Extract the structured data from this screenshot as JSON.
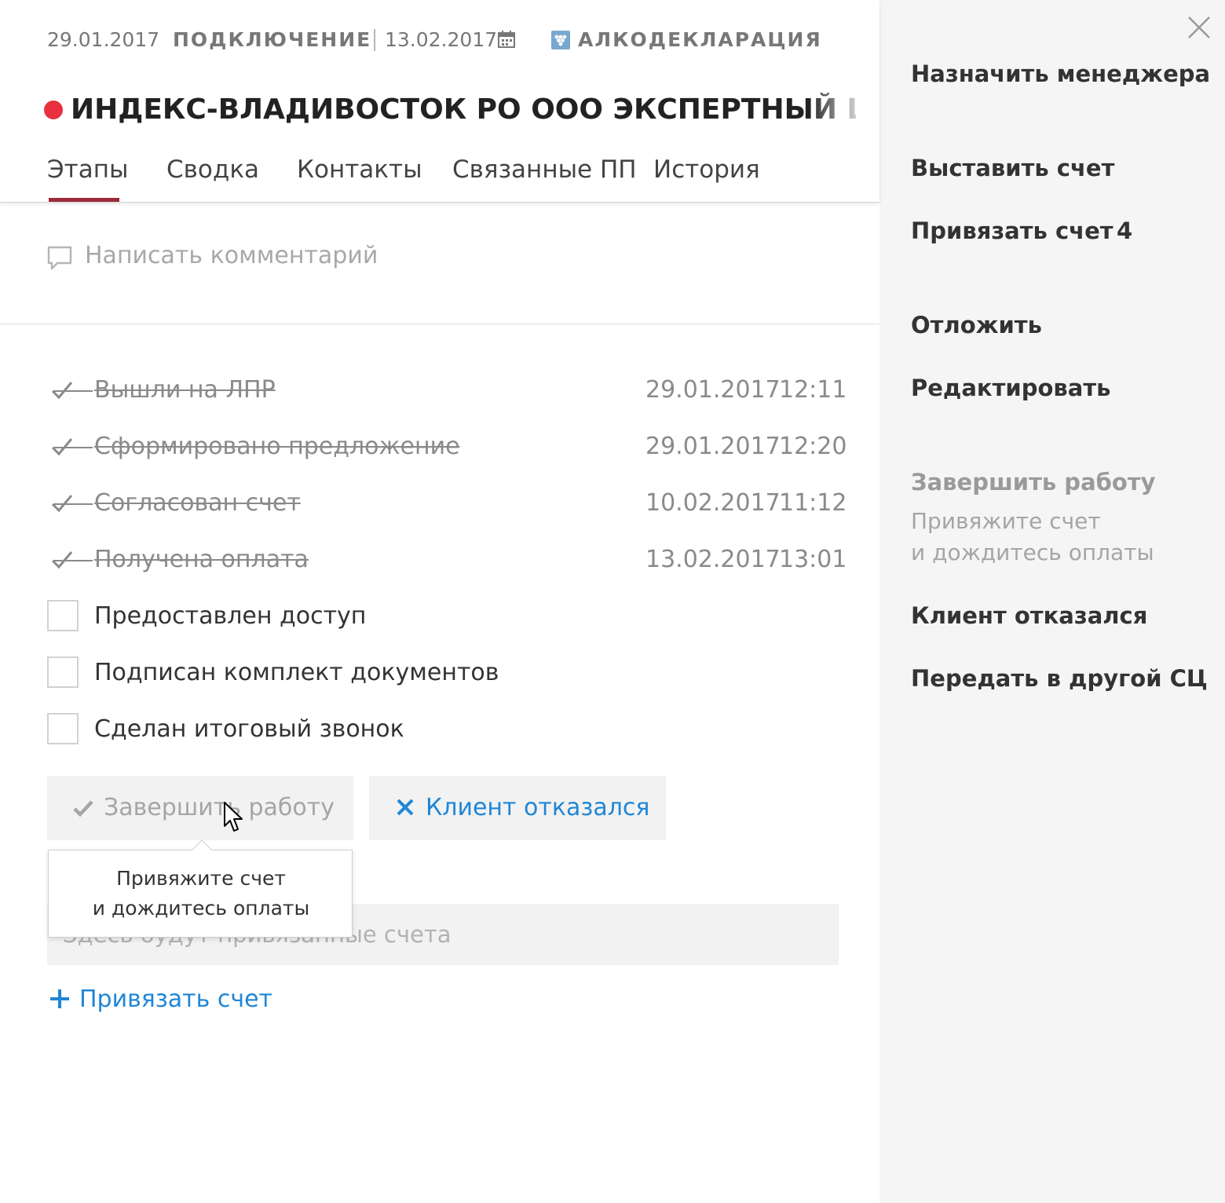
{
  "header": {
    "date": "29.01.2017",
    "connection_label": "ПОДКЛЮЧЕНИЕ",
    "connection_date": "13.02.2017",
    "product": "АЛКОДЕКЛАРАЦИЯ",
    "company_name": "ИНДЕКС-ВЛАДИВОСТОК РО ООО ЭКСПЕРТНЫЙ ЦЕНТР ИН",
    "status_color": "#e8303f",
    "tabs": [
      {
        "label": "Этапы",
        "active": true
      },
      {
        "label": "Сводка",
        "active": false
      },
      {
        "label": "Контакты",
        "active": false
      },
      {
        "label": "Связанные ПП",
        "active": false
      },
      {
        "label": "История",
        "active": false
      }
    ],
    "accent_color": "#9c2a3a"
  },
  "comment": {
    "placeholder": "Написать комментарий"
  },
  "stages": {
    "completed": [
      {
        "label": "Вышли на ЛПР",
        "date": "29.01.2017",
        "time": "12:11"
      },
      {
        "label": "Сформировано предложение",
        "date": "29.01.2017",
        "time": "12:20"
      },
      {
        "label": "Согласован счет",
        "date": "10.02.2017",
        "time": "11:12"
      },
      {
        "label": "Получена оплата",
        "date": "13.02.2017",
        "time": "13:01"
      }
    ],
    "pending": [
      {
        "label": "Предоставлен доступ",
        "checked": false
      },
      {
        "label": "Подписан комплект документов",
        "checked": false
      },
      {
        "label": "Сделан итоговый звонок",
        "checked": false
      }
    ]
  },
  "actions": {
    "finish_label": "Завершить работу",
    "reject_label": "Клиент отказался",
    "link_color": "#1f86d6"
  },
  "tooltip": {
    "line1": "Привяжите счет",
    "line2": "и дождитесь оплаты"
  },
  "invoices": {
    "empty_text": "Здесь будут привязанные счета",
    "attach_label": "Привязать счет"
  },
  "side_panel": {
    "assign_manager": "Назначить менеджера",
    "issue_invoice": "Выставить счет",
    "attach_invoice": "Привязать счет",
    "attach_invoice_count": "4",
    "postpone": "Отложить",
    "edit": "Редактировать",
    "finish": "Завершить работу",
    "finish_hint_1": "Привяжите счет",
    "finish_hint_2": "и дождитесь оплаты",
    "client_refused": "Клиент отказался",
    "transfer": "Передать в другой СЦ"
  }
}
